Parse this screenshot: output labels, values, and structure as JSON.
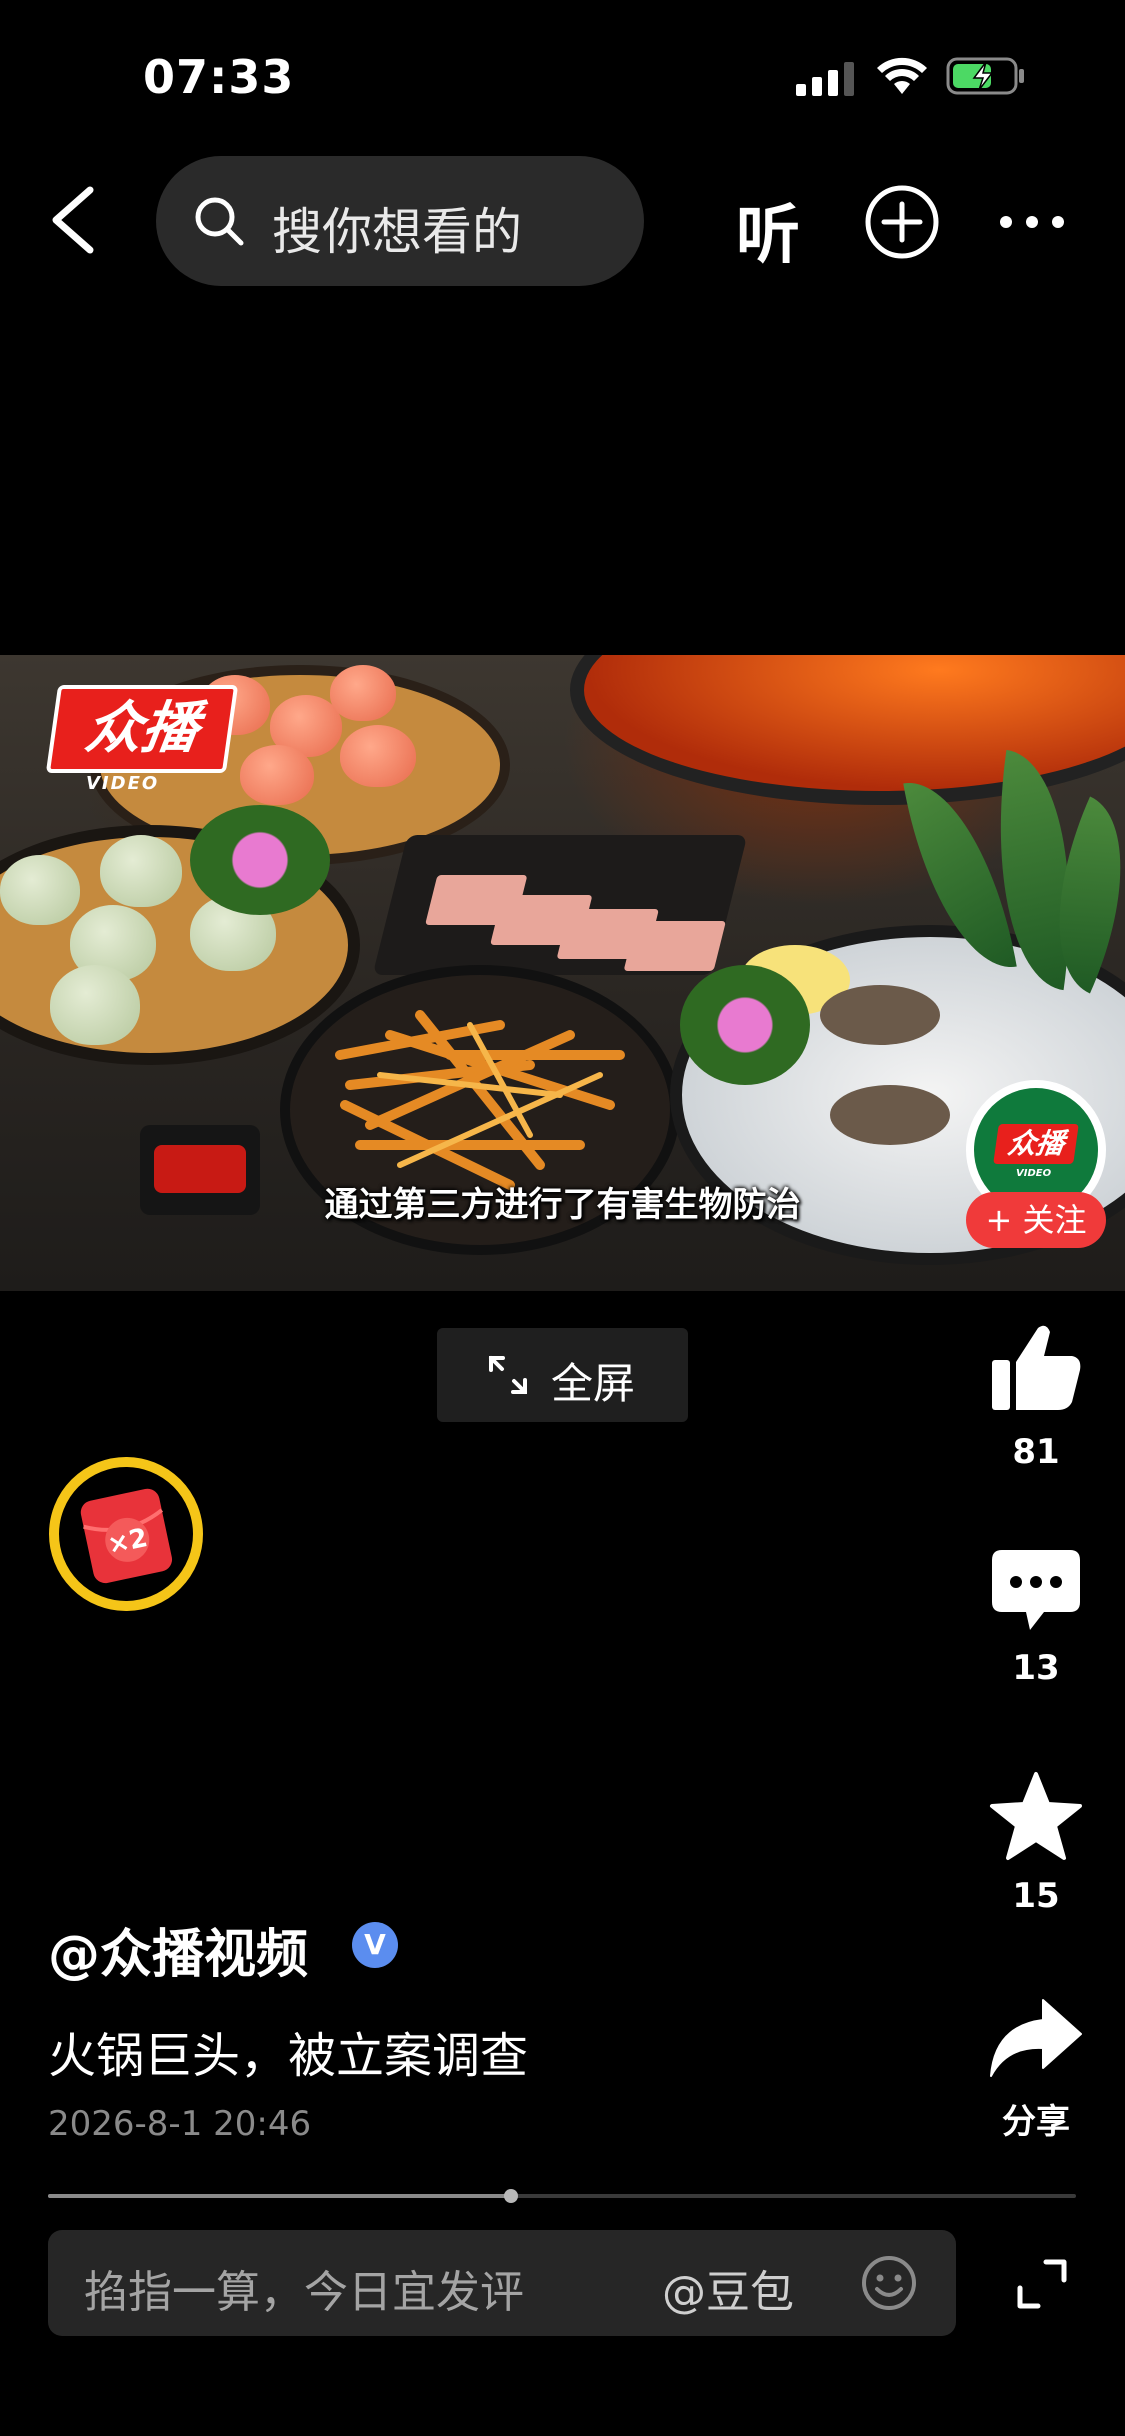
{
  "status_bar": {
    "time": "07:33",
    "icons": [
      "cellular-signal-icon",
      "wifi-icon",
      "battery-charging-icon"
    ]
  },
  "top_nav": {
    "search_placeholder": "搜你想看的",
    "listen_label": "听",
    "icons": [
      "back-icon",
      "search-icon",
      "add-circle-icon",
      "more-icon"
    ]
  },
  "video": {
    "brand_logo": "众播",
    "brand_sub": "VIDEO",
    "subtitle": "通过第三方进行了有害生物防治",
    "follow_label": "+ 关注",
    "avatar_logo": "众播",
    "avatar_sub": "VIDEO"
  },
  "fullscreen_button": {
    "label": "全屏"
  },
  "red_packet": {
    "multiplier": "×2"
  },
  "actions": {
    "like": {
      "count": "81"
    },
    "comment": {
      "count": "13"
    },
    "favorite": {
      "count": "15"
    },
    "share": {
      "label": "分享"
    }
  },
  "post": {
    "author": "@众播视频",
    "verified_mark": "V",
    "caption": "火锅巨头，被立案调查",
    "timestamp": "2026-8-1 20:46"
  },
  "playback": {
    "progress": 0.45
  },
  "comment_bar": {
    "placeholder": "掐指一算，今日宜发评",
    "mention": "@豆包"
  },
  "colors": {
    "accent_red": "#f03a3a",
    "verified_blue": "#5b8def",
    "packet_ring": "#f5c518"
  }
}
